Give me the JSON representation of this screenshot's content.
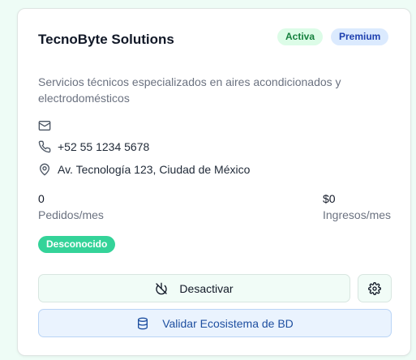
{
  "company": {
    "name": "TecnoByte Solutions",
    "description": "Servicios técnicos especializados en aires acondicionados y electrodomésticos",
    "badges": {
      "status": "Activa",
      "tier": "Premium"
    },
    "contact": {
      "email": "",
      "phone": "+52 55 1234 5678",
      "address": "Av. Tecnología 123, Ciudad de México"
    },
    "stats": {
      "orders_value": "0",
      "orders_label": "Pedidos/mes",
      "revenue_value": "$0",
      "revenue_label": "Ingresos/mes"
    },
    "connection_status": "Desconocido"
  },
  "actions": {
    "deactivate_label": "Desactivar",
    "validate_label": "Validar Ecosistema de BD"
  },
  "icons": {
    "email": "mail-icon",
    "phone": "phone-icon",
    "address": "map-pin-icon",
    "deactivate": "power-off-icon",
    "settings": "gear-icon",
    "validate": "database-icon"
  },
  "colors": {
    "background": "#eefcf6",
    "active_badge": "#dcfce7",
    "premium_badge": "#dbeafe",
    "status_pill": "#34d399",
    "validate_text": "#1e4fa0"
  }
}
